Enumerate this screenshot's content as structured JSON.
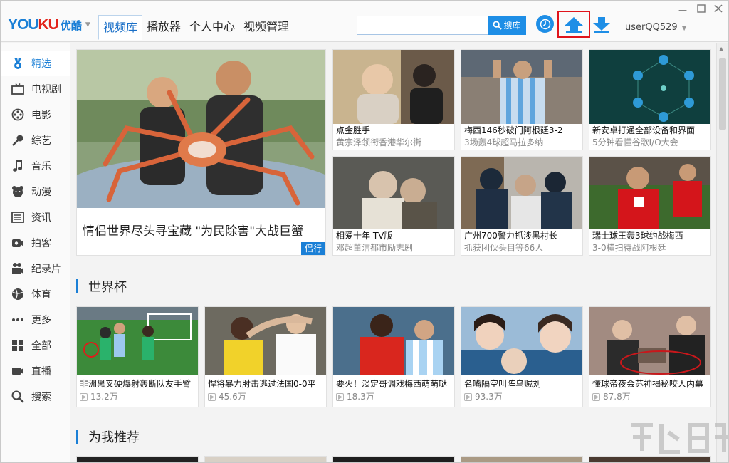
{
  "app": {
    "logo_en_a": "YOU",
    "logo_en_b": "KU",
    "logo_cn": "优酷",
    "username": "userQQ529"
  },
  "nav": {
    "tabs": [
      "视频库",
      "播放器",
      "个人中心",
      "视频管理"
    ],
    "active": 0
  },
  "search": {
    "value": "",
    "placeholder": "",
    "button_label": "搜库"
  },
  "sidebar": {
    "items": [
      {
        "label": "精选",
        "icon": "medal-icon"
      },
      {
        "label": "电视剧",
        "icon": "tv-icon"
      },
      {
        "label": "电影",
        "icon": "film-reel-icon"
      },
      {
        "label": "综艺",
        "icon": "microphone-icon"
      },
      {
        "label": "音乐",
        "icon": "music-note-icon"
      },
      {
        "label": "动漫",
        "icon": "bear-icon"
      },
      {
        "label": "资讯",
        "icon": "news-icon"
      },
      {
        "label": "拍客",
        "icon": "camera-icon"
      },
      {
        "label": "纪录片",
        "icon": "video-camera-icon"
      },
      {
        "label": "体育",
        "icon": "ball-icon"
      },
      {
        "label": "更多",
        "icon": "more-dots-icon"
      },
      {
        "label": "全部",
        "icon": "grid-icon"
      },
      {
        "label": "直播",
        "icon": "live-camera-icon"
      },
      {
        "label": "搜索",
        "icon": "search-icon"
      }
    ]
  },
  "featured": {
    "hero": {
      "title": "情侣世界尽头寻宝藏 \"为民除害\"大战巨蟹",
      "badge": "侣行"
    },
    "cards": [
      {
        "title": "点金胜手",
        "sub": "黄宗泽领衔香港华尔街"
      },
      {
        "title": "梅西146秒破门阿根廷3-2",
        "sub": "3场轰4球超马拉多纳"
      },
      {
        "title": "新安卓打通全部设备和界面",
        "sub": "5分钟看懂谷歌I/O大会"
      },
      {
        "title": "相爱十年 TV版",
        "sub": "邓超董洁都市励志剧"
      },
      {
        "title": "广州700警力抓涉黑村长",
        "sub": "抓获团伙头目等66人"
      },
      {
        "title": "瑞士球王轰3球约战梅西",
        "sub": "3-0横扫待战阿根廷"
      }
    ]
  },
  "sections": [
    {
      "title": "世界杯",
      "cards": [
        {
          "title": "非洲黑叉硬爆射轰断队友手臂",
          "plays": "13.2万"
        },
        {
          "title": "悍将暴力肘击逃过法国0-0平",
          "plays": "45.6万"
        },
        {
          "title": "要火！淡定哥调戏梅西萌萌哒",
          "plays": "18.3万"
        },
        {
          "title": "名嘴隔空叫阵乌贼刘",
          "plays": "93.3万"
        },
        {
          "title": "懂球帝夜会苏神揭秘咬人内幕",
          "plays": "87.8万"
        }
      ]
    },
    {
      "title": "为我推荐"
    }
  ],
  "colors": {
    "accent": "#1a7fd6",
    "highlight_frame": "#e0141b"
  }
}
